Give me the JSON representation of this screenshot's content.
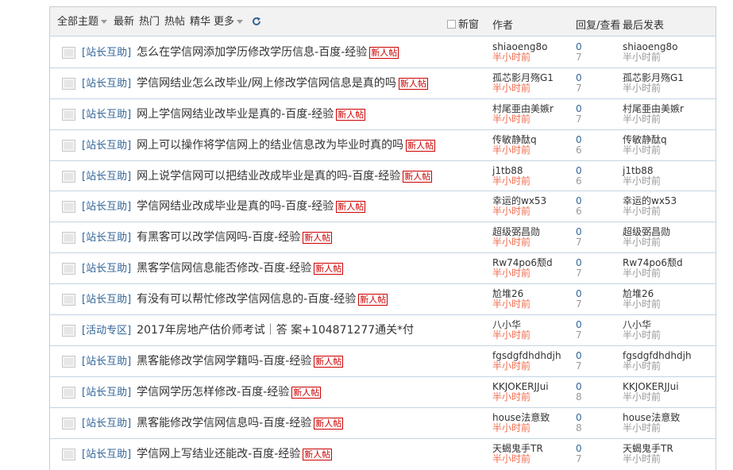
{
  "header": {
    "all_topics": "全部主题",
    "latest": "最新",
    "hot": "热门",
    "hot_posts": "热帖",
    "digest": "精华",
    "more": "更多",
    "new_window": "新窗",
    "author": "作者",
    "reply_view": "回复/查看",
    "last_post": "最后发表"
  },
  "badge": "新人帖",
  "rows": [
    {
      "category": "[站长互助]",
      "title": "怎么在学信网添加学历修改学历信息-百度-经验",
      "author": "shiaoeng8o",
      "time": "半小时前",
      "replies": "0",
      "views": "7",
      "last_author": "shiaoeng8o",
      "last_time": "半小时前"
    },
    {
      "category": "[站长互助]",
      "title": "学信网结业怎么改毕业/网上修改学信网信息是真的吗",
      "author": "孤芯影月殇G1",
      "time": "半小时前",
      "replies": "0",
      "views": "7",
      "last_author": "孤芯影月殇G1",
      "last_time": "半小时前"
    },
    {
      "category": "[站长互助]",
      "title": "网上学信网结业改毕业是真的-百度-经验",
      "author": "村尾亜由美嫉r",
      "time": "半小时前",
      "replies": "0",
      "views": "7",
      "last_author": "村尾亜由美嫉r",
      "last_time": "半小时前"
    },
    {
      "category": "[站长互助]",
      "title": "网上可以操作将学信网上的结业信息改为毕业时真的吗",
      "author": "传敏静酞q",
      "time": "半小时前",
      "replies": "0",
      "views": "6",
      "last_author": "传敏静酞q",
      "last_time": "半小时前"
    },
    {
      "category": "[站长互助]",
      "title": "网上说学信网可以把结业改成毕业是真的吗-百度-经验",
      "author": "j1tb88",
      "time": "半小时前",
      "replies": "0",
      "views": "6",
      "last_author": "j1tb88",
      "last_time": "半小时前"
    },
    {
      "category": "[站长互助]",
      "title": "学信网结业改成毕业是真的吗-百度-经验",
      "author": "幸运的wx53",
      "time": "半小时前",
      "replies": "0",
      "views": "6",
      "last_author": "幸运的wx53",
      "last_time": "半小时前"
    },
    {
      "category": "[站长互助]",
      "title": "有黑客可以改学信网吗-百度-经验",
      "author": "超级弼昌勋",
      "time": "半小时前",
      "replies": "0",
      "views": "7",
      "last_author": "超级弼昌勋",
      "last_time": "半小时前"
    },
    {
      "category": "[站长互助]",
      "title": "黑客学信网信息能否修改-百度-经验",
      "author": "Rw74po6颓d",
      "time": "半小时前",
      "replies": "0",
      "views": "7",
      "last_author": "Rw74po6颓d",
      "last_time": "半小时前"
    },
    {
      "category": "[站长互助]",
      "title": "有没有可以帮忙修改学信网信息的-百度-经验",
      "author": "尬堆26",
      "time": "半小时前",
      "replies": "0",
      "views": "7",
      "last_author": "尬堆26",
      "last_time": "半小时前"
    },
    {
      "category": "[活动专区]",
      "title": "2017年房地产估价师考试｜答 案+104871277通关*付",
      "author": "八小华",
      "time": "半小时前",
      "replies": "0",
      "views": "7",
      "last_author": "八小华",
      "last_time": "半小时前",
      "no_badge": true
    },
    {
      "category": "[站长互助]",
      "title": "黑客能修改学信网学籍吗-百度-经验",
      "author": "fgsdgfdhdhdjh",
      "time": "半小时前",
      "replies": "0",
      "views": "7",
      "last_author": "fgsdgfdhdhdjh",
      "last_time": "半小时前"
    },
    {
      "category": "[站长互助]",
      "title": "学信网学历怎样修改-百度-经验",
      "author": "KKJOKERJJui",
      "time": "半小时前",
      "replies": "0",
      "views": "8",
      "last_author": "KKJOKERJJui",
      "last_time": "半小时前"
    },
    {
      "category": "[站长互助]",
      "title": "黑客能修改学信网信息吗-百度-经验",
      "author": "house法意致",
      "time": "半小时前",
      "replies": "0",
      "views": "8",
      "last_author": "house法意致",
      "last_time": "半小时前"
    },
    {
      "category": "[站长互助]",
      "title": "学信网上写结业还能改-百度-经验",
      "author": "天蝎鬼手TR",
      "time": "半小时前",
      "replies": "0",
      "views": "7",
      "last_author": "天蝎鬼手TR",
      "last_time": "半小时前"
    }
  ]
}
